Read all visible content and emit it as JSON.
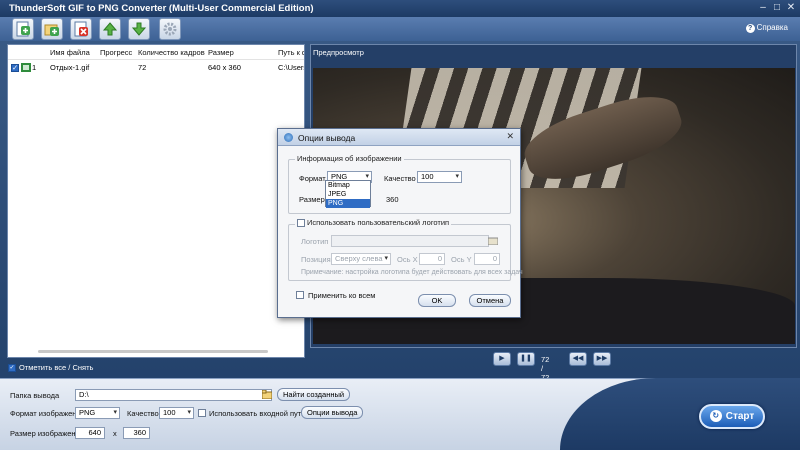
{
  "window": {
    "title": "ThunderSoft GIF to PNG Converter (Multi-User Commercial Edition)"
  },
  "toolbar": {
    "help_label": "Справка"
  },
  "file_list": {
    "columns": [
      "Имя файла",
      "Прогресс",
      "Количество кадров",
      "Размер",
      "Путь к ф"
    ],
    "rows": [
      {
        "index": "1",
        "name": "Отдых-1.gif",
        "progress": "",
        "frames": "72",
        "size": "640 x 360",
        "path": "C:\\Users\\"
      }
    ],
    "select_all_label": "Отметить все / Снять"
  },
  "preview": {
    "title": "Предпросмотр",
    "frame_counter": "72 / 72"
  },
  "bottom": {
    "output_folder_label": "Папка вывода",
    "output_folder_value": "D:\\",
    "find_created_label": "Найти созданный",
    "image_format_label": "Формат изображения",
    "image_format_value": "PNG",
    "quality_label": "Качество",
    "quality_value": "100",
    "use_input_path_label": "Использовать входной путь",
    "output_options_label": "Опции вывода",
    "image_size_label": "Размер изображения",
    "width_value": "640",
    "x_label": "x",
    "height_value": "360",
    "start_label": "Старт"
  },
  "dialog": {
    "title": "Опции вывода",
    "image_info_group": "Информация об изображении",
    "format_label": "Формат",
    "format_value": "PNG",
    "format_options": [
      "Bitmap",
      "JPEG",
      "PNG"
    ],
    "quality_label": "Качество",
    "quality_value": "100",
    "size_label": "Размер",
    "height_value": "360",
    "use_logo_label": "Использовать пользовательский логотип",
    "logo_label": "Логотип",
    "position_label": "Позиция",
    "position_value": "Сверху слева",
    "axis_x_label": "Ось X",
    "axis_x_value": "0",
    "axis_y_label": "Ось Y",
    "axis_y_value": "0",
    "note": "Примечание: настройка логотипа будет действовать для всех задач",
    "apply_all_label": "Применить ко всем",
    "ok_label": "OK",
    "cancel_label": "Отмена"
  },
  "colors": {
    "accent": "#2f6cc4",
    "titlebar": "#2e4e7c"
  }
}
